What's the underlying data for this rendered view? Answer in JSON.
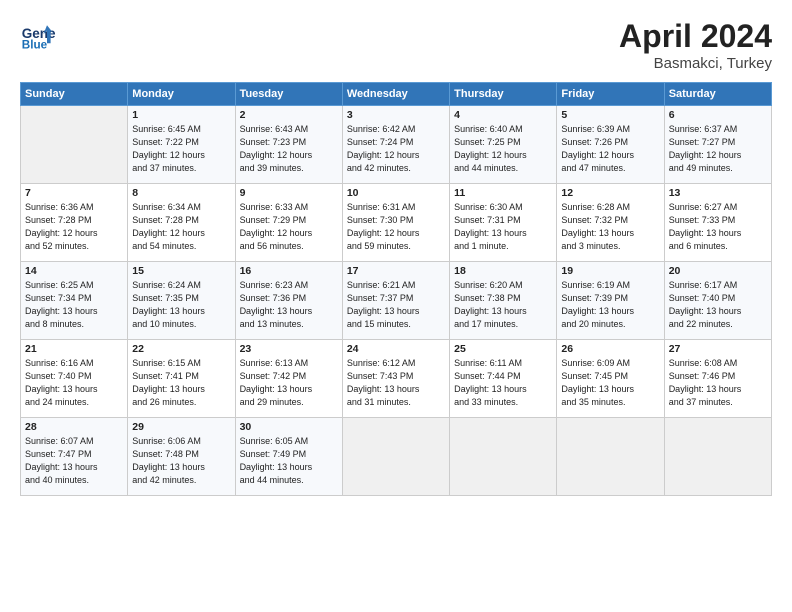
{
  "header": {
    "logo_line1": "General",
    "logo_line2": "Blue",
    "month": "April 2024",
    "location": "Basmakci, Turkey"
  },
  "weekdays": [
    "Sunday",
    "Monday",
    "Tuesday",
    "Wednesday",
    "Thursday",
    "Friday",
    "Saturday"
  ],
  "weeks": [
    [
      {
        "num": "",
        "info": ""
      },
      {
        "num": "1",
        "info": "Sunrise: 6:45 AM\nSunset: 7:22 PM\nDaylight: 12 hours\nand 37 minutes."
      },
      {
        "num": "2",
        "info": "Sunrise: 6:43 AM\nSunset: 7:23 PM\nDaylight: 12 hours\nand 39 minutes."
      },
      {
        "num": "3",
        "info": "Sunrise: 6:42 AM\nSunset: 7:24 PM\nDaylight: 12 hours\nand 42 minutes."
      },
      {
        "num": "4",
        "info": "Sunrise: 6:40 AM\nSunset: 7:25 PM\nDaylight: 12 hours\nand 44 minutes."
      },
      {
        "num": "5",
        "info": "Sunrise: 6:39 AM\nSunset: 7:26 PM\nDaylight: 12 hours\nand 47 minutes."
      },
      {
        "num": "6",
        "info": "Sunrise: 6:37 AM\nSunset: 7:27 PM\nDaylight: 12 hours\nand 49 minutes."
      }
    ],
    [
      {
        "num": "7",
        "info": "Sunrise: 6:36 AM\nSunset: 7:28 PM\nDaylight: 12 hours\nand 52 minutes."
      },
      {
        "num": "8",
        "info": "Sunrise: 6:34 AM\nSunset: 7:28 PM\nDaylight: 12 hours\nand 54 minutes."
      },
      {
        "num": "9",
        "info": "Sunrise: 6:33 AM\nSunset: 7:29 PM\nDaylight: 12 hours\nand 56 minutes."
      },
      {
        "num": "10",
        "info": "Sunrise: 6:31 AM\nSunset: 7:30 PM\nDaylight: 12 hours\nand 59 minutes."
      },
      {
        "num": "11",
        "info": "Sunrise: 6:30 AM\nSunset: 7:31 PM\nDaylight: 13 hours\nand 1 minute."
      },
      {
        "num": "12",
        "info": "Sunrise: 6:28 AM\nSunset: 7:32 PM\nDaylight: 13 hours\nand 3 minutes."
      },
      {
        "num": "13",
        "info": "Sunrise: 6:27 AM\nSunset: 7:33 PM\nDaylight: 13 hours\nand 6 minutes."
      }
    ],
    [
      {
        "num": "14",
        "info": "Sunrise: 6:25 AM\nSunset: 7:34 PM\nDaylight: 13 hours\nand 8 minutes."
      },
      {
        "num": "15",
        "info": "Sunrise: 6:24 AM\nSunset: 7:35 PM\nDaylight: 13 hours\nand 10 minutes."
      },
      {
        "num": "16",
        "info": "Sunrise: 6:23 AM\nSunset: 7:36 PM\nDaylight: 13 hours\nand 13 minutes."
      },
      {
        "num": "17",
        "info": "Sunrise: 6:21 AM\nSunset: 7:37 PM\nDaylight: 13 hours\nand 15 minutes."
      },
      {
        "num": "18",
        "info": "Sunrise: 6:20 AM\nSunset: 7:38 PM\nDaylight: 13 hours\nand 17 minutes."
      },
      {
        "num": "19",
        "info": "Sunrise: 6:19 AM\nSunset: 7:39 PM\nDaylight: 13 hours\nand 20 minutes."
      },
      {
        "num": "20",
        "info": "Sunrise: 6:17 AM\nSunset: 7:40 PM\nDaylight: 13 hours\nand 22 minutes."
      }
    ],
    [
      {
        "num": "21",
        "info": "Sunrise: 6:16 AM\nSunset: 7:40 PM\nDaylight: 13 hours\nand 24 minutes."
      },
      {
        "num": "22",
        "info": "Sunrise: 6:15 AM\nSunset: 7:41 PM\nDaylight: 13 hours\nand 26 minutes."
      },
      {
        "num": "23",
        "info": "Sunrise: 6:13 AM\nSunset: 7:42 PM\nDaylight: 13 hours\nand 29 minutes."
      },
      {
        "num": "24",
        "info": "Sunrise: 6:12 AM\nSunset: 7:43 PM\nDaylight: 13 hours\nand 31 minutes."
      },
      {
        "num": "25",
        "info": "Sunrise: 6:11 AM\nSunset: 7:44 PM\nDaylight: 13 hours\nand 33 minutes."
      },
      {
        "num": "26",
        "info": "Sunrise: 6:09 AM\nSunset: 7:45 PM\nDaylight: 13 hours\nand 35 minutes."
      },
      {
        "num": "27",
        "info": "Sunrise: 6:08 AM\nSunset: 7:46 PM\nDaylight: 13 hours\nand 37 minutes."
      }
    ],
    [
      {
        "num": "28",
        "info": "Sunrise: 6:07 AM\nSunset: 7:47 PM\nDaylight: 13 hours\nand 40 minutes."
      },
      {
        "num": "29",
        "info": "Sunrise: 6:06 AM\nSunset: 7:48 PM\nDaylight: 13 hours\nand 42 minutes."
      },
      {
        "num": "30",
        "info": "Sunrise: 6:05 AM\nSunset: 7:49 PM\nDaylight: 13 hours\nand 44 minutes."
      },
      {
        "num": "",
        "info": ""
      },
      {
        "num": "",
        "info": ""
      },
      {
        "num": "",
        "info": ""
      },
      {
        "num": "",
        "info": ""
      }
    ]
  ]
}
